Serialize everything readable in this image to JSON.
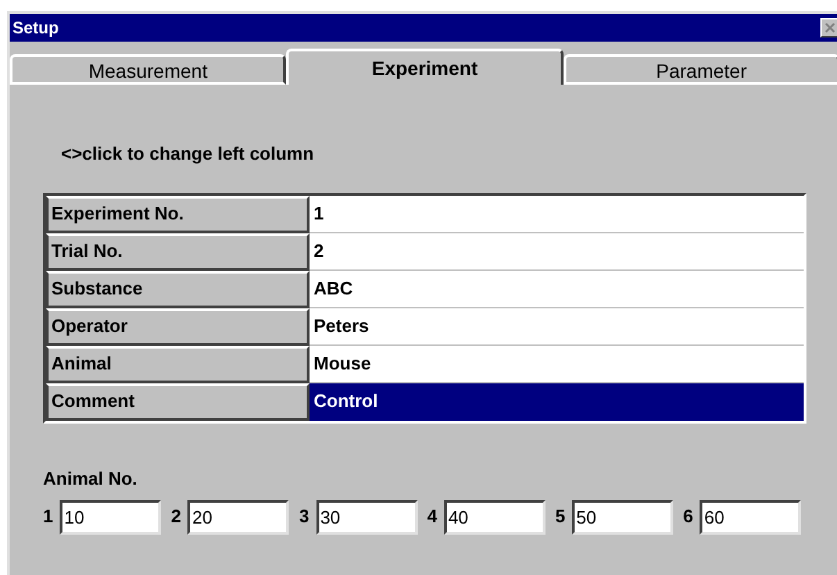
{
  "window": {
    "title": "Setup"
  },
  "tabs": [
    {
      "label": "Measurement",
      "selected": false
    },
    {
      "label": "Experiment",
      "selected": true
    },
    {
      "label": "Parameter",
      "selected": false
    }
  ],
  "hint": "<>click to change left column",
  "table": {
    "rows": [
      {
        "label": "Experiment No.",
        "value": "1",
        "selected": false
      },
      {
        "label": "Trial No.",
        "value": "2",
        "selected": false
      },
      {
        "label": "Substance",
        "value": "ABC",
        "selected": false
      },
      {
        "label": "Operator",
        "value": "Peters",
        "selected": false
      },
      {
        "label": "Animal",
        "value": "Mouse",
        "selected": false
      },
      {
        "label": "Comment",
        "value": "Control",
        "selected": true
      }
    ]
  },
  "animal_no": {
    "label": "Animal No.",
    "fields": [
      {
        "index": "1",
        "value": "10"
      },
      {
        "index": "2",
        "value": "20"
      },
      {
        "index": "3",
        "value": "30"
      },
      {
        "index": "4",
        "value": "40"
      },
      {
        "index": "5",
        "value": "50"
      },
      {
        "index": "6",
        "value": "60"
      }
    ]
  }
}
